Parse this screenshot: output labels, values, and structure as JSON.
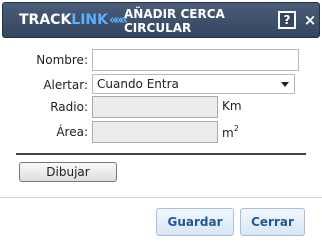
{
  "header": {
    "logo_part1": "TRACK",
    "logo_part2": "LINK",
    "logo_arrows": "«««",
    "title": "AÑADIR CERCA CIRCULAR",
    "help_label": "?",
    "close_label": "×"
  },
  "form": {
    "nombre_label": "Nombre:",
    "nombre_value": "",
    "alertar_label": "Alertar:",
    "alertar_value": "Cuando Entra",
    "radio_label": "Radio:",
    "radio_value": "",
    "radio_unit": "Km",
    "area_label": "Área:",
    "area_value": "",
    "area_unit": "m",
    "area_unit_exp": "2"
  },
  "actions": {
    "draw_label": "Dibujar",
    "save_label": "Guardar",
    "close_label": "Cerrar"
  },
  "colors": {
    "titlebar": "#3c4f6b",
    "accent": "#5ab0ff",
    "button_text": "#1f5a96"
  }
}
